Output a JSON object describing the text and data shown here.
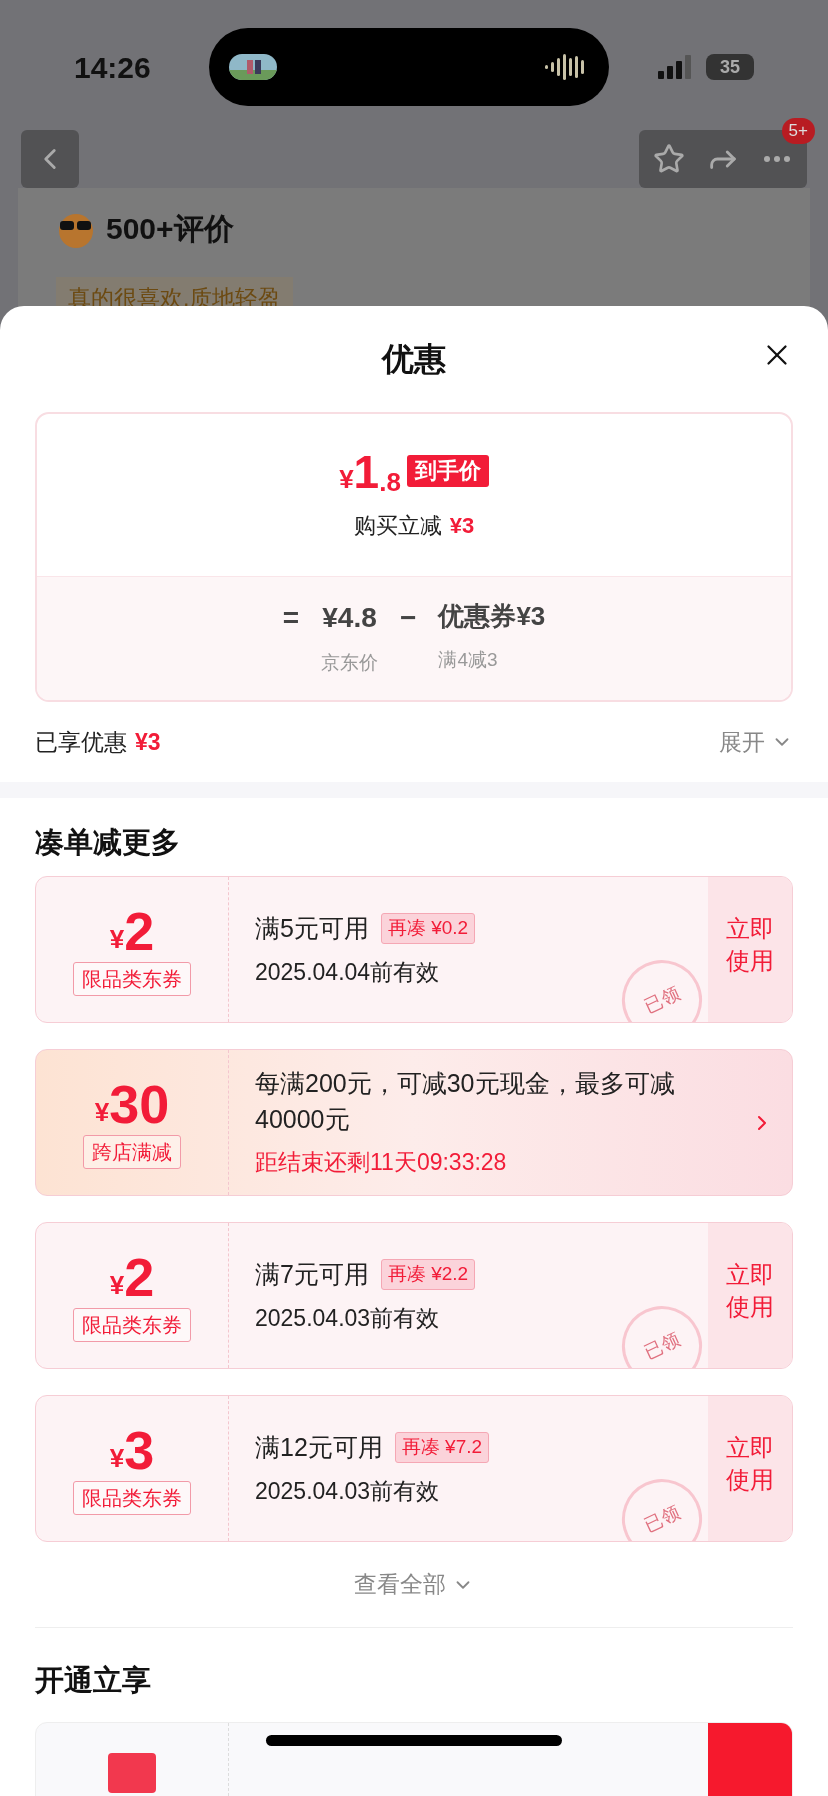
{
  "status_bar": {
    "time": "14:26",
    "battery": "35"
  },
  "nav": {
    "badge": "5+"
  },
  "behind": {
    "reviews_title": "500+评价",
    "review_tag": "真的很喜欢,质地轻盈"
  },
  "sheet": {
    "title": "优惠",
    "price": {
      "currency": "¥",
      "integer": "1",
      "decimal": ".8",
      "tag": "到手价",
      "saving_label": "购买立减",
      "saving": "¥3",
      "equals": "=",
      "base_price": "¥4.8",
      "minus": "−",
      "coupon": "优惠券¥3",
      "base_caption": "京东价",
      "coupon_caption": "满4减3"
    },
    "enjoyed": {
      "label": "已享优惠",
      "amount": "¥3",
      "expand": "展开"
    },
    "section_title": "凑单减更多",
    "coupons": [
      {
        "kind": "coupon",
        "currency": "¥",
        "amount": "2",
        "type": "限品类东券",
        "condition": "满5元可用",
        "top_up": "再凑 ¥0.2",
        "validity": "2025.04.04前有效",
        "action": "立即使用",
        "stamp": "已领"
      },
      {
        "kind": "promo",
        "currency": "¥",
        "amount": "30",
        "type": "跨店满减",
        "condition": "每满200元，可减30元现金，最多可减40000元",
        "countdown": "距结束还剩11天09:33:28"
      },
      {
        "kind": "coupon",
        "currency": "¥",
        "amount": "2",
        "type": "限品类东券",
        "condition": "满7元可用",
        "top_up": "再凑 ¥2.2",
        "validity": "2025.04.03前有效",
        "action": "立即使用",
        "stamp": "已领"
      },
      {
        "kind": "coupon",
        "currency": "¥",
        "amount": "3",
        "type": "限品类东券",
        "condition": "满12元可用",
        "top_up": "再凑 ¥7.2",
        "validity": "2025.04.03前有效",
        "action": "立即使用",
        "stamp": "已领"
      }
    ],
    "view_all": "查看全部",
    "section2_title": "开通立享"
  }
}
